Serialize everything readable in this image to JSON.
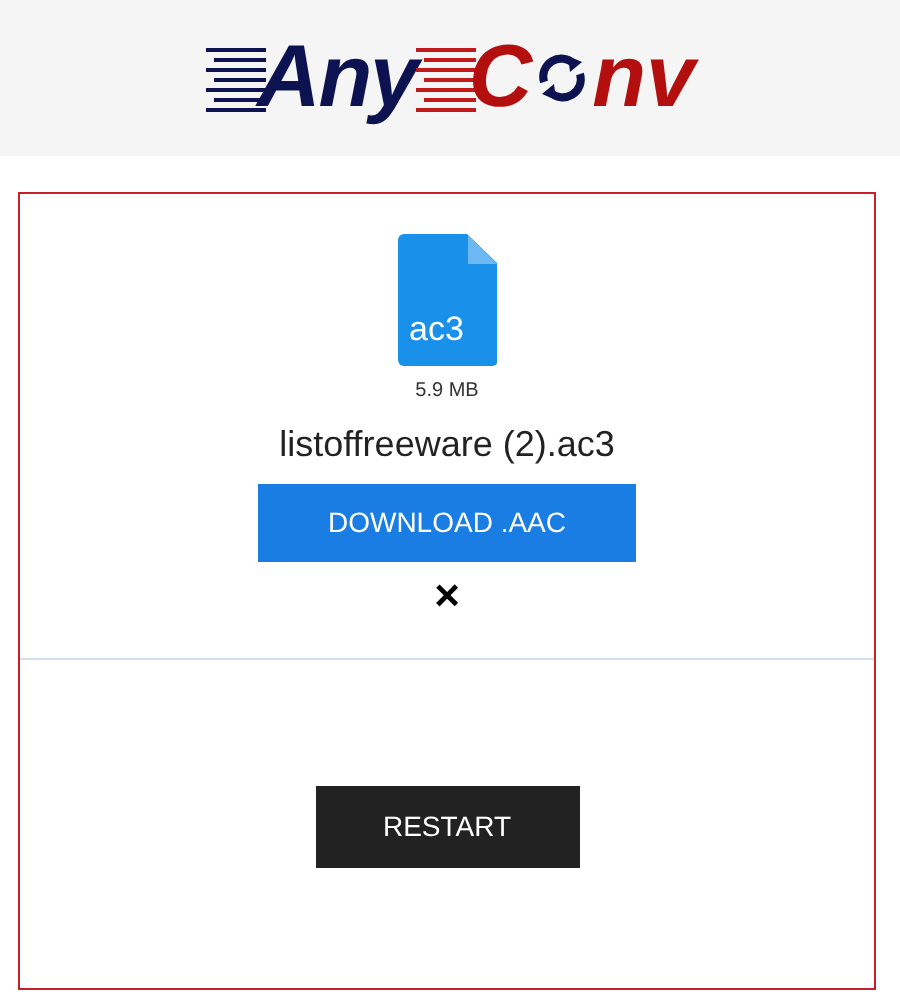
{
  "logo": {
    "first": "Any",
    "second": "C",
    "third": "nv"
  },
  "file": {
    "extension": "ac3",
    "size": "5.9 MB",
    "name": "listoffreeware (2).ac3"
  },
  "download_button": "DOWNLOAD .AAC",
  "remove_button": "×",
  "restart_button": "RESTART"
}
